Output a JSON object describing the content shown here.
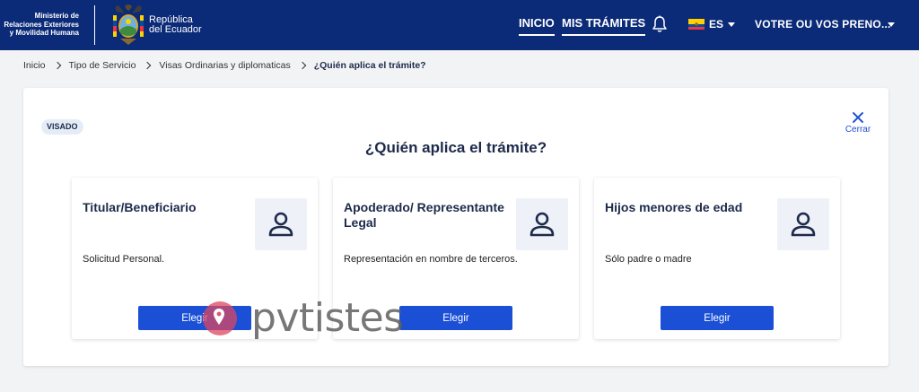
{
  "header": {
    "ministry_lines": [
      "Ministerio de",
      "Relaciones Exteriores",
      "y Movilidad Humana"
    ],
    "republic_lines": [
      "República",
      "del Ecuador"
    ],
    "nav": [
      {
        "label": "INICIO"
      },
      {
        "label": "MIS TRÁMITES"
      }
    ],
    "language": "ES",
    "user_name": "VOTRE OU VOS PRENO...",
    "icons": {
      "notifications": "bell-icon",
      "flag": "ecuador-flag-icon",
      "dropdown": "chevron-down-icon",
      "crest": "ecuador-crest-icon"
    },
    "colors": {
      "background": "#0b2a78",
      "flag_yellow": "#ffd100",
      "flag_blue": "#034ea2",
      "flag_red": "#ef3340"
    }
  },
  "breadcrumb": [
    "Inicio",
    "Tipo de Servicio",
    "Visas Ordinarias y diplomaticas",
    "¿Quién aplica el trámite?"
  ],
  "panel": {
    "badge": "VISADO",
    "close_label": "Cerrar",
    "title": "¿Quién aplica el trámite?"
  },
  "cards": [
    {
      "title": "Titular/Beneficiario",
      "description": "Solicitud Personal.",
      "button": "Elegir",
      "icon": "user-icon"
    },
    {
      "title": "Apoderado/ Representante Legal",
      "description": "Representación en nombre de terceros.",
      "button": "Elegir",
      "icon": "user-icon"
    },
    {
      "title": "Hijos menores de edad",
      "description": "Sólo padre o madre",
      "button": "Elegir",
      "icon": "user-icon"
    }
  ],
  "watermark": {
    "text": "pvtistes",
    "icon": "location-pin-icon"
  },
  "colors": {
    "primary_button": "#1a4fd6",
    "link": "#1f4fd1",
    "text": "#1e2a4a",
    "badge_bg": "#e4edf6",
    "page_bg": "#f2f3f5"
  }
}
